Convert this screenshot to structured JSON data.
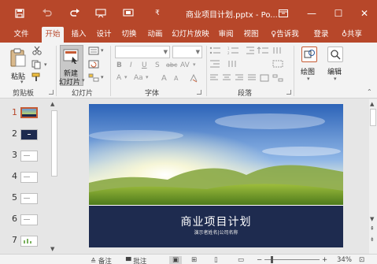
{
  "window": {
    "title": "商业项目计划.pptx - Po...",
    "controls": {
      "minimize": "—",
      "maximize": "☐",
      "close": "✕"
    }
  },
  "tabs": [
    {
      "label": "文件",
      "active": false
    },
    {
      "label": "开始",
      "active": true
    },
    {
      "label": "插入",
      "active": false
    },
    {
      "label": "设计",
      "active": false
    },
    {
      "label": "切换",
      "active": false
    },
    {
      "label": "动画",
      "active": false
    },
    {
      "label": "幻灯片放映",
      "active": false
    },
    {
      "label": "审阅",
      "active": false
    },
    {
      "label": "视图",
      "active": false
    },
    {
      "label": "告诉我",
      "active": false
    }
  ],
  "account": {
    "login": "登录",
    "share": "共享"
  },
  "ribbon": {
    "clipboard": {
      "paste_label": "粘贴",
      "group_label": "剪贴板"
    },
    "slides": {
      "new_slide_line1": "新建",
      "new_slide_line2": "幻灯片",
      "group_label": "幻灯片"
    },
    "font": {
      "group_label": "字体",
      "bold": "B",
      "italic": "I",
      "underline": "U",
      "shadow": "S",
      "strike": "abc",
      "spacing": "AV",
      "font_color": "A",
      "change_case": "Aa",
      "grow": "A",
      "shrink": "A"
    },
    "paragraph": {
      "group_label": "段落"
    },
    "drawing": {
      "label": "绘图"
    },
    "editing": {
      "label": "编辑"
    }
  },
  "thumbnails": [
    {
      "number": "1",
      "kind": "photo",
      "active": true
    },
    {
      "number": "2",
      "kind": "dark",
      "active": false
    },
    {
      "number": "3",
      "kind": "text",
      "active": false
    },
    {
      "number": "4",
      "kind": "text",
      "active": false
    },
    {
      "number": "5",
      "kind": "text",
      "active": false
    },
    {
      "number": "6",
      "kind": "text",
      "active": false
    },
    {
      "number": "7",
      "kind": "chart",
      "active": false
    }
  ],
  "slide": {
    "title": "商业项目计划",
    "subtitle": "演示者姓名|公司名称"
  },
  "statusbar": {
    "notes": "备注",
    "comments": "批注",
    "zoom": "34%"
  },
  "colors": {
    "brand": "#b7472a",
    "ribbon_bg": "#f3f3f3",
    "slide_band": "#1e2b4f"
  }
}
